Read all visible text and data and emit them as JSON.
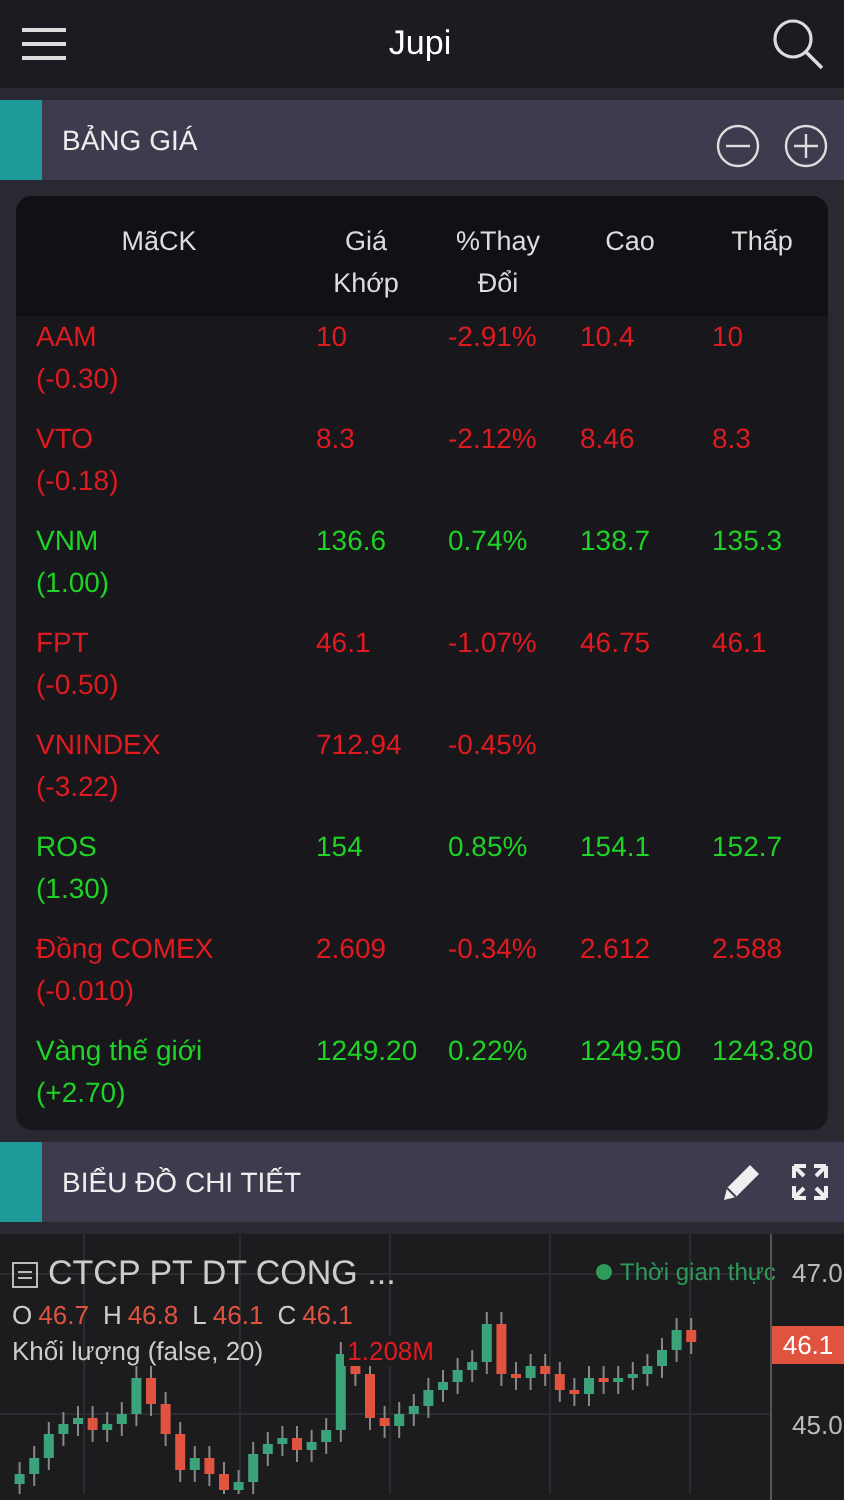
{
  "app_bar": {
    "title": "Jupi"
  },
  "price_board": {
    "title": "BẢNG GIÁ",
    "columns": [
      "MãCK",
      "Giá Khớp",
      "%Thay Đổi",
      "Cao",
      "Thấp"
    ],
    "rows": [
      {
        "kind": "down",
        "symbol": "AAM",
        "change": "(-0.30)",
        "price": "10",
        "percent": "-2.91%",
        "high": "10.4",
        "low": "10"
      },
      {
        "kind": "down",
        "symbol": "VTO",
        "change": "(-0.18)",
        "price": "8.3",
        "percent": "-2.12%",
        "high": "8.46",
        "low": "8.3"
      },
      {
        "kind": "up",
        "symbol": "VNM",
        "change": "(1.00)",
        "price": "136.6",
        "percent": "0.74%",
        "high": "138.7",
        "low": "135.3"
      },
      {
        "kind": "down",
        "symbol": "FPT",
        "change": "(-0.50)",
        "price": "46.1",
        "percent": "-1.07%",
        "high": "46.75",
        "low": "46.1"
      },
      {
        "kind": "down",
        "symbol": "VNINDEX",
        "change": "(-3.22)",
        "price": "712.94",
        "percent": "-0.45%"
      },
      {
        "kind": "up",
        "symbol": "ROS",
        "change": "(1.30)",
        "price": "154",
        "percent": "0.85%",
        "high": "154.1",
        "low": "152.7"
      },
      {
        "kind": "down",
        "symbol": "Đồng COMEX",
        "change": "(-0.010)",
        "price": "2.609",
        "percent": "-0.34%",
        "high": "2.612",
        "low": "2.588"
      },
      {
        "kind": "up",
        "symbol": "Vàng thế giới",
        "change": "(+2.70)",
        "price": "1249.20",
        "percent": "0.22%",
        "high": "1249.50",
        "low": "1243.80"
      }
    ]
  },
  "detail_chart": {
    "title": "BIỂU ĐỒ CHI TIẾT",
    "instrument": "CTCP PT DT CONG ...",
    "realtime": "Thời gian thực",
    "ohlc": [
      {
        "label": "O",
        "value": "46.7"
      },
      {
        "label": "H",
        "value": "46.8"
      },
      {
        "label": "L",
        "value": "46.1"
      },
      {
        "label": "C",
        "value": "46.1"
      }
    ],
    "volume_label": "Khối lượng (false, 20)",
    "volume_value": "1.208M",
    "axis_labels": [
      "47.0",
      "45.0"
    ],
    "last_price": "46.1"
  }
}
